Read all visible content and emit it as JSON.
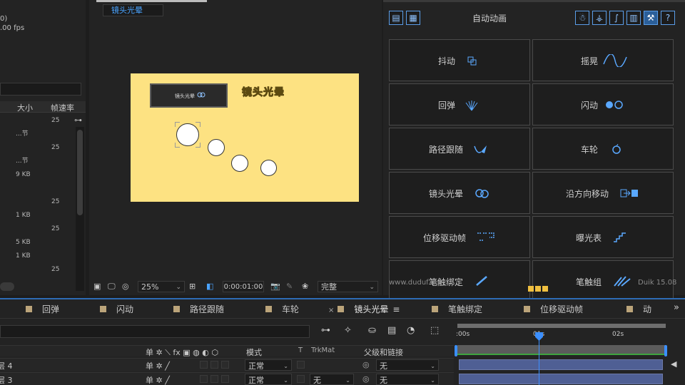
{
  "project": {
    "info_line1": "0)",
    "info_line2": ".00 fps",
    "col_size": "大小",
    "col_fps": "帧速率",
    "rows": [
      {
        "size": "",
        "fps": "25"
      },
      {
        "size": "...节",
        "fps": ""
      },
      {
        "size": "",
        "fps": "25"
      },
      {
        "size": "...节",
        "fps": ""
      },
      {
        "size": "9 KB",
        "fps": ""
      },
      {
        "size": "",
        "fps": ""
      },
      {
        "size": "",
        "fps": "25"
      },
      {
        "size": "1 KB",
        "fps": ""
      },
      {
        "size": "",
        "fps": "25"
      },
      {
        "size": "5 KB",
        "fps": ""
      },
      {
        "size": "1 KB",
        "fps": ""
      },
      {
        "size": "",
        "fps": "25"
      }
    ]
  },
  "viewer": {
    "comp_tab": "镜头光晕",
    "canvas_title": "镜头光晕",
    "mini_panel_label": "镜头光晕",
    "zoom": "25%",
    "timecode": "0:00:01:00",
    "quality": "完整",
    "canvas_color": "#fde282"
  },
  "duik": {
    "title": "自动动画",
    "buttons": [
      {
        "label": "抖动",
        "icon": "wiggle-icon"
      },
      {
        "label": "摇晃",
        "icon": "swing-icon"
      },
      {
        "label": "回弹",
        "icon": "bounce-icon"
      },
      {
        "label": "闪动",
        "icon": "blink-icon"
      },
      {
        "label": "路径跟随",
        "icon": "path-follow-icon"
      },
      {
        "label": "车轮",
        "icon": "wheel-icon"
      },
      {
        "label": "镜头光晕",
        "icon": "lens-flare-icon"
      },
      {
        "label": "沿方向移动",
        "icon": "move-away-icon"
      },
      {
        "label": "位移驱动帧",
        "icon": "distance-link-icon"
      },
      {
        "label": "曝光表",
        "icon": "exposure-icon"
      },
      {
        "label": "笔触绑定",
        "icon": "paint-rig-icon"
      },
      {
        "label": "笔触组",
        "icon": "paint-group-icon"
      }
    ],
    "footer_url": "www.duduf.net",
    "version": "Duik 15.08",
    "accent": "#5a9de8"
  },
  "timeline": {
    "tabs": [
      "回弹",
      "闪动",
      "路径跟随",
      "车轮",
      "镜头光晕",
      "笔触绑定",
      "位移驱动帧",
      "动"
    ],
    "active_tab": "镜头光晕",
    "columns": {
      "mode": "模式",
      "t": "T",
      "trkmat": "TrkMat",
      "parent": "父级和链接"
    },
    "layers": [
      {
        "name": "层 4",
        "mode": "正常",
        "trkmat": "",
        "parent": "无"
      },
      {
        "name": "层 3",
        "mode": "正常",
        "trkmat": "无",
        "parent": "无"
      }
    ],
    "ruler": {
      "t0": ":00s",
      "t1": "01s",
      "t2": "02s"
    }
  }
}
